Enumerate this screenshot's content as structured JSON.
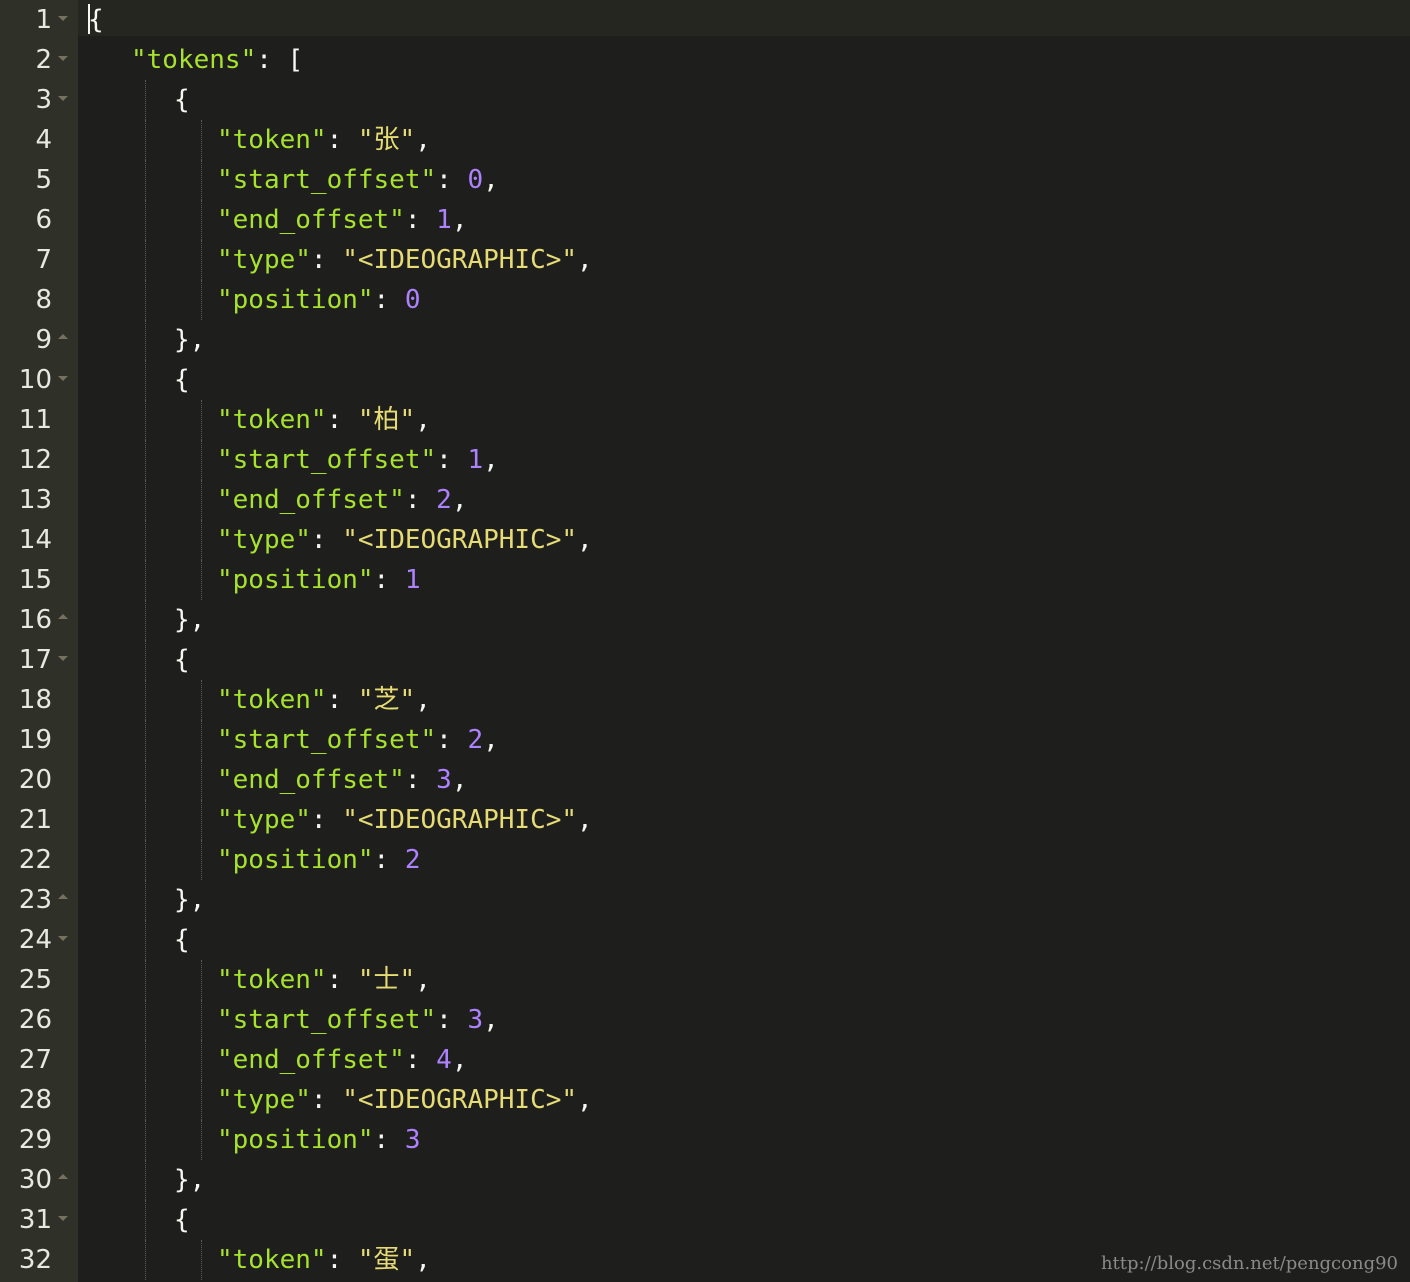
{
  "colors": {
    "background": "#1e1f1c",
    "gutter": "#2f3129",
    "key": "#a6e22e",
    "string": "#e6db74",
    "number": "#ae81ff",
    "punctuation": "#f8f8f2"
  },
  "watermark": "http://blog.csdn.net/pengcong90",
  "lines": [
    {
      "n": "1",
      "fold": "open",
      "indent": 0,
      "parts": [
        [
          "pun",
          "{"
        ]
      ]
    },
    {
      "n": "2",
      "fold": "open",
      "indent": 1,
      "parts": [
        [
          "key",
          "\"tokens\""
        ],
        [
          "pun",
          ": ["
        ]
      ]
    },
    {
      "n": "3",
      "fold": "open",
      "indent": 2,
      "parts": [
        [
          "pun",
          "{"
        ]
      ]
    },
    {
      "n": "4",
      "fold": "",
      "indent": 3,
      "parts": [
        [
          "key",
          "\"token\""
        ],
        [
          "pun",
          ": "
        ],
        [
          "str",
          "\"张\""
        ],
        [
          "pun",
          ","
        ]
      ]
    },
    {
      "n": "5",
      "fold": "",
      "indent": 3,
      "parts": [
        [
          "key",
          "\"start_offset\""
        ],
        [
          "pun",
          ": "
        ],
        [
          "num",
          "0"
        ],
        [
          "pun",
          ","
        ]
      ]
    },
    {
      "n": "6",
      "fold": "",
      "indent": 3,
      "parts": [
        [
          "key",
          "\"end_offset\""
        ],
        [
          "pun",
          ": "
        ],
        [
          "num",
          "1"
        ],
        [
          "pun",
          ","
        ]
      ]
    },
    {
      "n": "7",
      "fold": "",
      "indent": 3,
      "parts": [
        [
          "key",
          "\"type\""
        ],
        [
          "pun",
          ": "
        ],
        [
          "str",
          "\"<IDEOGRAPHIC>\""
        ],
        [
          "pun",
          ","
        ]
      ]
    },
    {
      "n": "8",
      "fold": "",
      "indent": 3,
      "parts": [
        [
          "key",
          "\"position\""
        ],
        [
          "pun",
          ": "
        ],
        [
          "num",
          "0"
        ]
      ]
    },
    {
      "n": "9",
      "fold": "close",
      "indent": 2,
      "parts": [
        [
          "pun",
          "},"
        ]
      ]
    },
    {
      "n": "10",
      "fold": "open",
      "indent": 2,
      "parts": [
        [
          "pun",
          "{"
        ]
      ]
    },
    {
      "n": "11",
      "fold": "",
      "indent": 3,
      "parts": [
        [
          "key",
          "\"token\""
        ],
        [
          "pun",
          ": "
        ],
        [
          "str",
          "\"柏\""
        ],
        [
          "pun",
          ","
        ]
      ]
    },
    {
      "n": "12",
      "fold": "",
      "indent": 3,
      "parts": [
        [
          "key",
          "\"start_offset\""
        ],
        [
          "pun",
          ": "
        ],
        [
          "num",
          "1"
        ],
        [
          "pun",
          ","
        ]
      ]
    },
    {
      "n": "13",
      "fold": "",
      "indent": 3,
      "parts": [
        [
          "key",
          "\"end_offset\""
        ],
        [
          "pun",
          ": "
        ],
        [
          "num",
          "2"
        ],
        [
          "pun",
          ","
        ]
      ]
    },
    {
      "n": "14",
      "fold": "",
      "indent": 3,
      "parts": [
        [
          "key",
          "\"type\""
        ],
        [
          "pun",
          ": "
        ],
        [
          "str",
          "\"<IDEOGRAPHIC>\""
        ],
        [
          "pun",
          ","
        ]
      ]
    },
    {
      "n": "15",
      "fold": "",
      "indent": 3,
      "parts": [
        [
          "key",
          "\"position\""
        ],
        [
          "pun",
          ": "
        ],
        [
          "num",
          "1"
        ]
      ]
    },
    {
      "n": "16",
      "fold": "close",
      "indent": 2,
      "parts": [
        [
          "pun",
          "},"
        ]
      ]
    },
    {
      "n": "17",
      "fold": "open",
      "indent": 2,
      "parts": [
        [
          "pun",
          "{"
        ]
      ]
    },
    {
      "n": "18",
      "fold": "",
      "indent": 3,
      "parts": [
        [
          "key",
          "\"token\""
        ],
        [
          "pun",
          ": "
        ],
        [
          "str",
          "\"芝\""
        ],
        [
          "pun",
          ","
        ]
      ]
    },
    {
      "n": "19",
      "fold": "",
      "indent": 3,
      "parts": [
        [
          "key",
          "\"start_offset\""
        ],
        [
          "pun",
          ": "
        ],
        [
          "num",
          "2"
        ],
        [
          "pun",
          ","
        ]
      ]
    },
    {
      "n": "20",
      "fold": "",
      "indent": 3,
      "parts": [
        [
          "key",
          "\"end_offset\""
        ],
        [
          "pun",
          ": "
        ],
        [
          "num",
          "3"
        ],
        [
          "pun",
          ","
        ]
      ]
    },
    {
      "n": "21",
      "fold": "",
      "indent": 3,
      "parts": [
        [
          "key",
          "\"type\""
        ],
        [
          "pun",
          ": "
        ],
        [
          "str",
          "\"<IDEOGRAPHIC>\""
        ],
        [
          "pun",
          ","
        ]
      ]
    },
    {
      "n": "22",
      "fold": "",
      "indent": 3,
      "parts": [
        [
          "key",
          "\"position\""
        ],
        [
          "pun",
          ": "
        ],
        [
          "num",
          "2"
        ]
      ]
    },
    {
      "n": "23",
      "fold": "close",
      "indent": 2,
      "parts": [
        [
          "pun",
          "},"
        ]
      ]
    },
    {
      "n": "24",
      "fold": "open",
      "indent": 2,
      "parts": [
        [
          "pun",
          "{"
        ]
      ]
    },
    {
      "n": "25",
      "fold": "",
      "indent": 3,
      "parts": [
        [
          "key",
          "\"token\""
        ],
        [
          "pun",
          ": "
        ],
        [
          "str",
          "\"士\""
        ],
        [
          "pun",
          ","
        ]
      ]
    },
    {
      "n": "26",
      "fold": "",
      "indent": 3,
      "parts": [
        [
          "key",
          "\"start_offset\""
        ],
        [
          "pun",
          ": "
        ],
        [
          "num",
          "3"
        ],
        [
          "pun",
          ","
        ]
      ]
    },
    {
      "n": "27",
      "fold": "",
      "indent": 3,
      "parts": [
        [
          "key",
          "\"end_offset\""
        ],
        [
          "pun",
          ": "
        ],
        [
          "num",
          "4"
        ],
        [
          "pun",
          ","
        ]
      ]
    },
    {
      "n": "28",
      "fold": "",
      "indent": 3,
      "parts": [
        [
          "key",
          "\"type\""
        ],
        [
          "pun",
          ": "
        ],
        [
          "str",
          "\"<IDEOGRAPHIC>\""
        ],
        [
          "pun",
          ","
        ]
      ]
    },
    {
      "n": "29",
      "fold": "",
      "indent": 3,
      "parts": [
        [
          "key",
          "\"position\""
        ],
        [
          "pun",
          ": "
        ],
        [
          "num",
          "3"
        ]
      ]
    },
    {
      "n": "30",
      "fold": "close",
      "indent": 2,
      "parts": [
        [
          "pun",
          "},"
        ]
      ]
    },
    {
      "n": "31",
      "fold": "open",
      "indent": 2,
      "parts": [
        [
          "pun",
          "{"
        ]
      ]
    },
    {
      "n": "32",
      "fold": "",
      "indent": 3,
      "parts": [
        [
          "key",
          "\"token\""
        ],
        [
          "pun",
          ": "
        ],
        [
          "str",
          "\"蛋\""
        ],
        [
          "pun",
          ","
        ]
      ]
    }
  ]
}
